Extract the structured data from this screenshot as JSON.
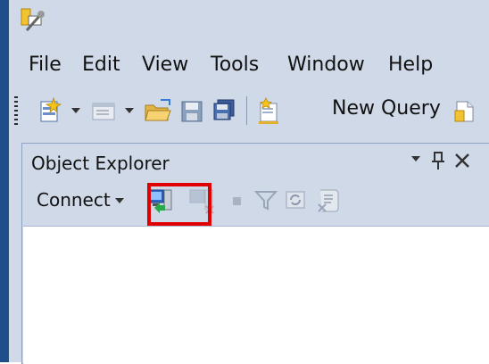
{
  "menu": [
    "File",
    "Edit",
    "View",
    "Tools",
    "Window",
    "Help"
  ],
  "toolbar": {
    "new_query_label": "New Query"
  },
  "object_explorer": {
    "title": "Object Explorer",
    "connect_label": "Connect",
    "highlight_color": "#e00000"
  },
  "icons": {
    "app": "ssms-app-icon",
    "new_project": "new-project-icon",
    "add_item": "add-item-icon",
    "open": "open-folder-icon",
    "save": "save-icon",
    "save_all": "save-all-icon",
    "new_query": "new-query-icon",
    "extra": "file-icon",
    "connect_object_explorer": "connect-object-explorer-icon",
    "disconnect": "disconnect-icon",
    "stop": "stop-icon",
    "filter": "filter-icon",
    "refresh": "refresh-icon",
    "scripts": "script-icon"
  }
}
